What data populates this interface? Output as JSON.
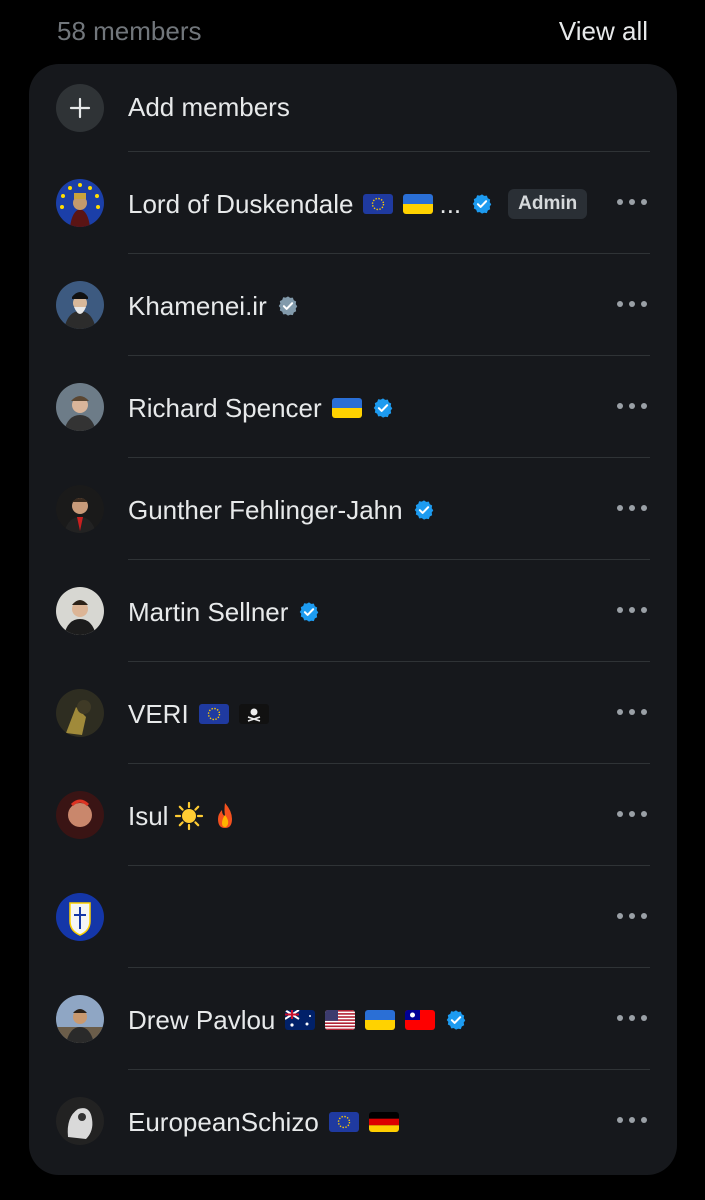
{
  "header": {
    "member_count": "58 members",
    "view_all": "View all"
  },
  "add_members": {
    "label": "Add members",
    "icon": "plus-icon"
  },
  "members": [
    {
      "name": "Lord of Duskendale",
      "flags": [
        "eu",
        "ua"
      ],
      "truncated": "...",
      "verified": "blue",
      "role": "Admin"
    },
    {
      "name": "Khamenei.ir",
      "flags": [],
      "verified": "gray"
    },
    {
      "name": "Richard Spencer",
      "flags": [
        "ua"
      ],
      "verified": "blue"
    },
    {
      "name": "Gunther Fehlinger-Jahn",
      "flags": [],
      "verified": "blue"
    },
    {
      "name": "Martin Sellner",
      "flags": [],
      "verified": "blue"
    },
    {
      "name": "VERI",
      "flags": [
        "eu",
        "pirate"
      ],
      "verified": null
    },
    {
      "name": "Isul",
      "emojis": [
        "sun",
        "fire"
      ],
      "verified": null
    },
    {
      "name": "",
      "flags": [],
      "verified": null
    },
    {
      "name": "Drew Pavlou",
      "flags": [
        "au",
        "us",
        "ua",
        "tw"
      ],
      "verified": "blue"
    },
    {
      "name": "EuropeanSchizo",
      "flags": [
        "eu",
        "de"
      ],
      "verified": null
    }
  ],
  "colors": {
    "verified_blue": "#1d9bf0",
    "verified_gray": "#829aab",
    "background": "#000000",
    "card": "#16181c"
  }
}
